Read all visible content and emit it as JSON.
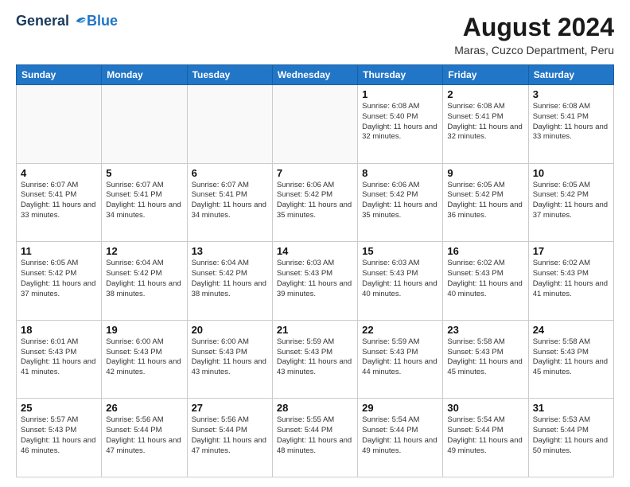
{
  "header": {
    "logo": {
      "general": "General",
      "blue": "Blue"
    },
    "title": "August 2024",
    "location": "Maras, Cuzco Department, Peru"
  },
  "weekdays": [
    "Sunday",
    "Monday",
    "Tuesday",
    "Wednesday",
    "Thursday",
    "Friday",
    "Saturday"
  ],
  "weeks": [
    [
      {
        "day": "",
        "sunrise": "",
        "sunset": "",
        "daylight": ""
      },
      {
        "day": "",
        "sunrise": "",
        "sunset": "",
        "daylight": ""
      },
      {
        "day": "",
        "sunrise": "",
        "sunset": "",
        "daylight": ""
      },
      {
        "day": "",
        "sunrise": "",
        "sunset": "",
        "daylight": ""
      },
      {
        "day": "1",
        "sunrise": "Sunrise: 6:08 AM",
        "sunset": "Sunset: 5:40 PM",
        "daylight": "Daylight: 11 hours and 32 minutes."
      },
      {
        "day": "2",
        "sunrise": "Sunrise: 6:08 AM",
        "sunset": "Sunset: 5:41 PM",
        "daylight": "Daylight: 11 hours and 32 minutes."
      },
      {
        "day": "3",
        "sunrise": "Sunrise: 6:08 AM",
        "sunset": "Sunset: 5:41 PM",
        "daylight": "Daylight: 11 hours and 33 minutes."
      }
    ],
    [
      {
        "day": "4",
        "sunrise": "Sunrise: 6:07 AM",
        "sunset": "Sunset: 5:41 PM",
        "daylight": "Daylight: 11 hours and 33 minutes."
      },
      {
        "day": "5",
        "sunrise": "Sunrise: 6:07 AM",
        "sunset": "Sunset: 5:41 PM",
        "daylight": "Daylight: 11 hours and 34 minutes."
      },
      {
        "day": "6",
        "sunrise": "Sunrise: 6:07 AM",
        "sunset": "Sunset: 5:41 PM",
        "daylight": "Daylight: 11 hours and 34 minutes."
      },
      {
        "day": "7",
        "sunrise": "Sunrise: 6:06 AM",
        "sunset": "Sunset: 5:42 PM",
        "daylight": "Daylight: 11 hours and 35 minutes."
      },
      {
        "day": "8",
        "sunrise": "Sunrise: 6:06 AM",
        "sunset": "Sunset: 5:42 PM",
        "daylight": "Daylight: 11 hours and 35 minutes."
      },
      {
        "day": "9",
        "sunrise": "Sunrise: 6:05 AM",
        "sunset": "Sunset: 5:42 PM",
        "daylight": "Daylight: 11 hours and 36 minutes."
      },
      {
        "day": "10",
        "sunrise": "Sunrise: 6:05 AM",
        "sunset": "Sunset: 5:42 PM",
        "daylight": "Daylight: 11 hours and 37 minutes."
      }
    ],
    [
      {
        "day": "11",
        "sunrise": "Sunrise: 6:05 AM",
        "sunset": "Sunset: 5:42 PM",
        "daylight": "Daylight: 11 hours and 37 minutes."
      },
      {
        "day": "12",
        "sunrise": "Sunrise: 6:04 AM",
        "sunset": "Sunset: 5:42 PM",
        "daylight": "Daylight: 11 hours and 38 minutes."
      },
      {
        "day": "13",
        "sunrise": "Sunrise: 6:04 AM",
        "sunset": "Sunset: 5:42 PM",
        "daylight": "Daylight: 11 hours and 38 minutes."
      },
      {
        "day": "14",
        "sunrise": "Sunrise: 6:03 AM",
        "sunset": "Sunset: 5:43 PM",
        "daylight": "Daylight: 11 hours and 39 minutes."
      },
      {
        "day": "15",
        "sunrise": "Sunrise: 6:03 AM",
        "sunset": "Sunset: 5:43 PM",
        "daylight": "Daylight: 11 hours and 40 minutes."
      },
      {
        "day": "16",
        "sunrise": "Sunrise: 6:02 AM",
        "sunset": "Sunset: 5:43 PM",
        "daylight": "Daylight: 11 hours and 40 minutes."
      },
      {
        "day": "17",
        "sunrise": "Sunrise: 6:02 AM",
        "sunset": "Sunset: 5:43 PM",
        "daylight": "Daylight: 11 hours and 41 minutes."
      }
    ],
    [
      {
        "day": "18",
        "sunrise": "Sunrise: 6:01 AM",
        "sunset": "Sunset: 5:43 PM",
        "daylight": "Daylight: 11 hours and 41 minutes."
      },
      {
        "day": "19",
        "sunrise": "Sunrise: 6:00 AM",
        "sunset": "Sunset: 5:43 PM",
        "daylight": "Daylight: 11 hours and 42 minutes."
      },
      {
        "day": "20",
        "sunrise": "Sunrise: 6:00 AM",
        "sunset": "Sunset: 5:43 PM",
        "daylight": "Daylight: 11 hours and 43 minutes."
      },
      {
        "day": "21",
        "sunrise": "Sunrise: 5:59 AM",
        "sunset": "Sunset: 5:43 PM",
        "daylight": "Daylight: 11 hours and 43 minutes."
      },
      {
        "day": "22",
        "sunrise": "Sunrise: 5:59 AM",
        "sunset": "Sunset: 5:43 PM",
        "daylight": "Daylight: 11 hours and 44 minutes."
      },
      {
        "day": "23",
        "sunrise": "Sunrise: 5:58 AM",
        "sunset": "Sunset: 5:43 PM",
        "daylight": "Daylight: 11 hours and 45 minutes."
      },
      {
        "day": "24",
        "sunrise": "Sunrise: 5:58 AM",
        "sunset": "Sunset: 5:43 PM",
        "daylight": "Daylight: 11 hours and 45 minutes."
      }
    ],
    [
      {
        "day": "25",
        "sunrise": "Sunrise: 5:57 AM",
        "sunset": "Sunset: 5:43 PM",
        "daylight": "Daylight: 11 hours and 46 minutes."
      },
      {
        "day": "26",
        "sunrise": "Sunrise: 5:56 AM",
        "sunset": "Sunset: 5:44 PM",
        "daylight": "Daylight: 11 hours and 47 minutes."
      },
      {
        "day": "27",
        "sunrise": "Sunrise: 5:56 AM",
        "sunset": "Sunset: 5:44 PM",
        "daylight": "Daylight: 11 hours and 47 minutes."
      },
      {
        "day": "28",
        "sunrise": "Sunrise: 5:55 AM",
        "sunset": "Sunset: 5:44 PM",
        "daylight": "Daylight: 11 hours and 48 minutes."
      },
      {
        "day": "29",
        "sunrise": "Sunrise: 5:54 AM",
        "sunset": "Sunset: 5:44 PM",
        "daylight": "Daylight: 11 hours and 49 minutes."
      },
      {
        "day": "30",
        "sunrise": "Sunrise: 5:54 AM",
        "sunset": "Sunset: 5:44 PM",
        "daylight": "Daylight: 11 hours and 49 minutes."
      },
      {
        "day": "31",
        "sunrise": "Sunrise: 5:53 AM",
        "sunset": "Sunset: 5:44 PM",
        "daylight": "Daylight: 11 hours and 50 minutes."
      }
    ]
  ]
}
